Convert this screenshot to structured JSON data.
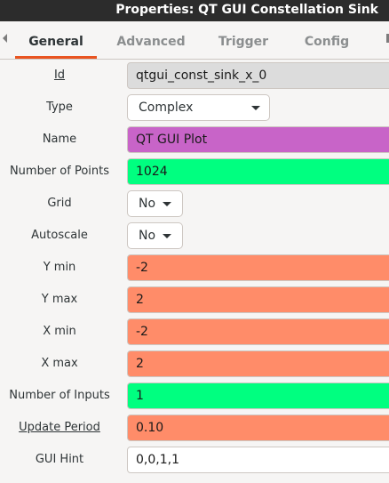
{
  "window": {
    "title": "Properties: QT GUI Constellation Sink"
  },
  "tabs": [
    {
      "label": "General",
      "active": true
    },
    {
      "label": "Advanced",
      "active": false
    },
    {
      "label": "Trigger",
      "active": false
    },
    {
      "label": "Config",
      "active": false
    }
  ],
  "fields": {
    "id": {
      "label": "Id",
      "value": "qtgui_const_sink_x_0",
      "color": "#dcdcdc"
    },
    "type": {
      "label": "Type",
      "value": "Complex"
    },
    "name": {
      "label": "Name",
      "value": "QT GUI Plot",
      "color": "#c864c8"
    },
    "num_points": {
      "label": "Number of Points",
      "value": "1024",
      "color": "#00ff80"
    },
    "grid": {
      "label": "Grid",
      "value": "No"
    },
    "autoscale": {
      "label": "Autoscale",
      "value": "No"
    },
    "ymin": {
      "label": "Y min",
      "value": "-2",
      "color": "#ff8c69"
    },
    "ymax": {
      "label": "Y max",
      "value": "2",
      "color": "#ff8c69"
    },
    "xmin": {
      "label": "X min",
      "value": "-2",
      "color": "#ff8c69"
    },
    "xmax": {
      "label": "X max",
      "value": "2",
      "color": "#ff8c69"
    },
    "num_inputs": {
      "label": "Number of Inputs",
      "value": "1",
      "color": "#00ff80"
    },
    "update_period": {
      "label": "Update Period",
      "value": "0.10",
      "color": "#ff8c69"
    },
    "gui_hint": {
      "label": "GUI Hint",
      "value": "0,0,1,1",
      "color": "#ffffff"
    }
  }
}
